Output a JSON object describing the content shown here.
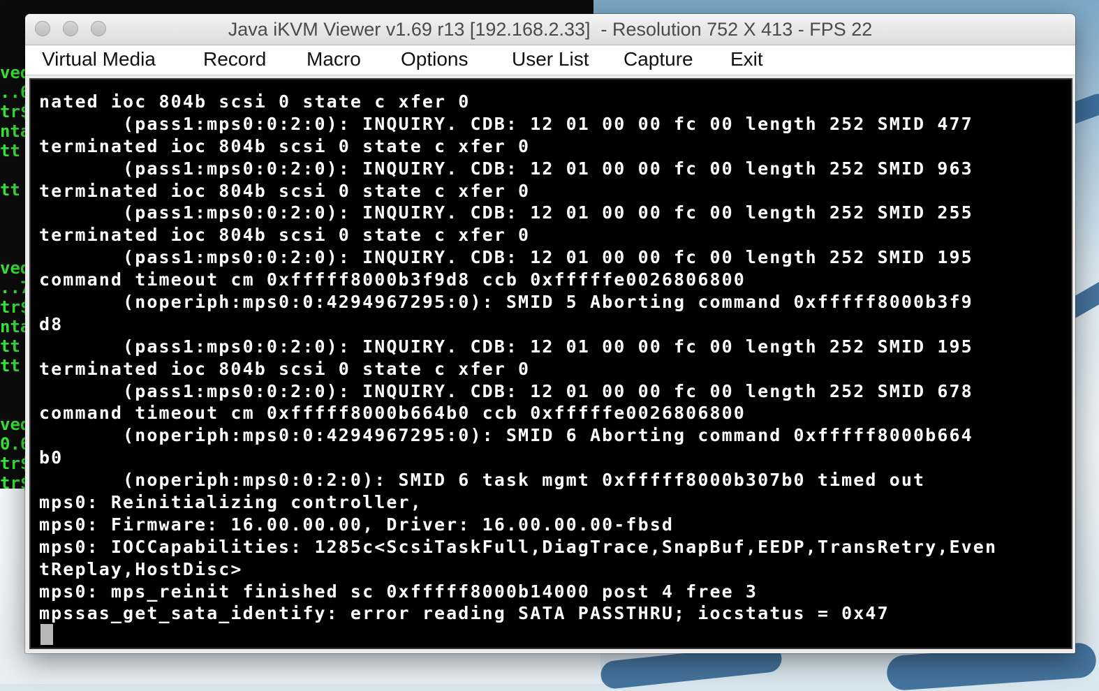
{
  "window": {
    "title": "Java iKVM Viewer v1.69 r13 [192.168.2.33]  - Resolution 752 X 413 - FPS 22"
  },
  "menu": {
    "items": [
      "Virtual Media",
      "Record",
      "Macro",
      "Options",
      "User List",
      "Capture",
      "Exit"
    ]
  },
  "console": {
    "lines": [
      "nated ioc 804b scsi 0 state c xfer 0",
      "       (pass1:mps0:0:2:0): INQUIRY. CDB: 12 01 00 00 fc 00 length 252 SMID 477",
      "terminated ioc 804b scsi 0 state c xfer 0",
      "       (pass1:mps0:0:2:0): INQUIRY. CDB: 12 01 00 00 fc 00 length 252 SMID 963",
      "terminated ioc 804b scsi 0 state c xfer 0",
      "       (pass1:mps0:0:2:0): INQUIRY. CDB: 12 01 00 00 fc 00 length 252 SMID 255",
      "terminated ioc 804b scsi 0 state c xfer 0",
      "       (pass1:mps0:0:2:0): INQUIRY. CDB: 12 01 00 00 fc 00 length 252 SMID 195",
      "command timeout cm 0xfffff8000b3f9d8 ccb 0xfffffe0026806800",
      "       (noperiph:mps0:0:4294967295:0): SMID 5 Aborting command 0xfffff8000b3f9",
      "d8",
      "       (pass1:mps0:0:2:0): INQUIRY. CDB: 12 01 00 00 fc 00 length 252 SMID 195",
      "terminated ioc 804b scsi 0 state c xfer 0",
      "       (pass1:mps0:0:2:0): INQUIRY. CDB: 12 01 00 00 fc 00 length 252 SMID 678",
      "command timeout cm 0xfffff8000b664b0 ccb 0xfffffe0026806800",
      "       (noperiph:mps0:0:4294967295:0): SMID 6 Aborting command 0xfffff8000b664",
      "b0",
      "       (noperiph:mps0:0:2:0): SMID 6 task mgmt 0xfffff8000b307b0 timed out",
      "mps0: Reinitializing controller,",
      "mps0: Firmware: 16.00.00.00, Driver: 16.00.00.00-fbsd",
      "mps0: IOCCapabilities: 1285c<ScsiTaskFull,DiagTrace,SnapBuf,EEDP,TransRetry,Even",
      "tReplay,HostDisc>",
      "mps0: mps_reinit finished sc 0xfffff8000b14000 post 4 free 3",
      "mpssas_get_sata_identify: error reading SATA PASSTHRU; iocstatus = 0x47"
    ]
  },
  "background_terminal": {
    "lines": [
      "ved",
      "..6",
      "tr$",
      "nta",
      "tt",
      "",
      "tt",
      "",
      "",
      "",
      "ved",
      "..7",
      "tr$",
      "nta",
      "tt",
      "tt",
      "",
      "",
      "ved",
      "0.6",
      "tr$",
      "tr$"
    ]
  },
  "colors": {
    "console_bg": "#000000",
    "console_fg": "#ffffff",
    "bg_terminal_fg": "#39e639"
  }
}
